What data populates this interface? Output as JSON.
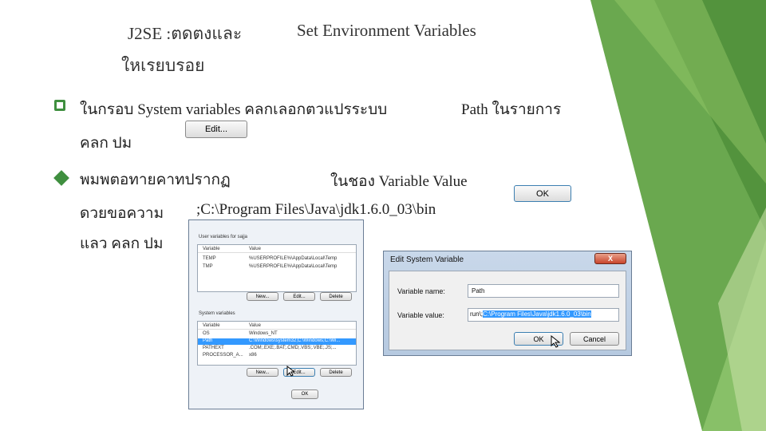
{
  "slide": {
    "title_left": "J2SE :ตดตงและ",
    "title_left_line2": "ใหเรยบรอย",
    "title_right": "Set Environment Variables",
    "bullet1_line1_a": "ในกรอบ System variables คลกเลอกตวแปรระบบ",
    "bullet1_line1_b": "Path ในรายการ",
    "bullet1_line2": "คลก  ปม",
    "bullet2_line1_a": "พมพตอทายคาทปรากฏ",
    "bullet2_line1_b": "ในชอง  Variable Value",
    "bullet2_line2_a": "ดวยขอความ",
    "bullet2_line2_b": ";C:\\Program Files\\Java\\jdk1.6.0_03\\bin",
    "bullet2_line3": "แลว  คลก  ปม"
  },
  "inline_buttons": {
    "edit_label": "Edit...",
    "ok_label": "OK"
  },
  "env_dialog": {
    "user_section": "User variables for sajja",
    "col_variable": "Variable",
    "col_value": "Value",
    "user_rows": [
      {
        "name": "TEMP",
        "value": "%USERPROFILE%\\AppData\\Local\\Temp"
      },
      {
        "name": "TMP",
        "value": "%USERPROFILE%\\AppData\\Local\\Temp"
      }
    ],
    "user_buttons": [
      "New...",
      "Edit...",
      "Delete"
    ],
    "system_section": "System variables",
    "system_rows": [
      {
        "name": "OS",
        "value": "Windows_NT"
      },
      {
        "name": "Path",
        "value": "C:\\Windows\\system32;C:\\Windows;C:\\Wi..."
      },
      {
        "name": "PATHEXT",
        "value": ".COM;.EXE;.BAT;.CMD;.VBS;.VBE;.JS;..."
      },
      {
        "name": "PROCESSOR_A...",
        "value": "x86"
      }
    ],
    "system_buttons": [
      "New...",
      "Edit...",
      "Delete"
    ],
    "ok_label": "OK"
  },
  "edit_dialog": {
    "title": "Edit System Variable",
    "close_label": "X",
    "name_label": "Variable name:",
    "name_value": "Path",
    "value_label": "Variable value:",
    "value_prefix": "run\\;",
    "value_selected": "C:\\Program Files\\Java\\jdk1.6.0_03\\bin",
    "ok_label": "OK",
    "cancel_label": "Cancel"
  },
  "colors": {
    "accent_green": "#3f8f3f",
    "selection_blue": "#3399ff"
  }
}
